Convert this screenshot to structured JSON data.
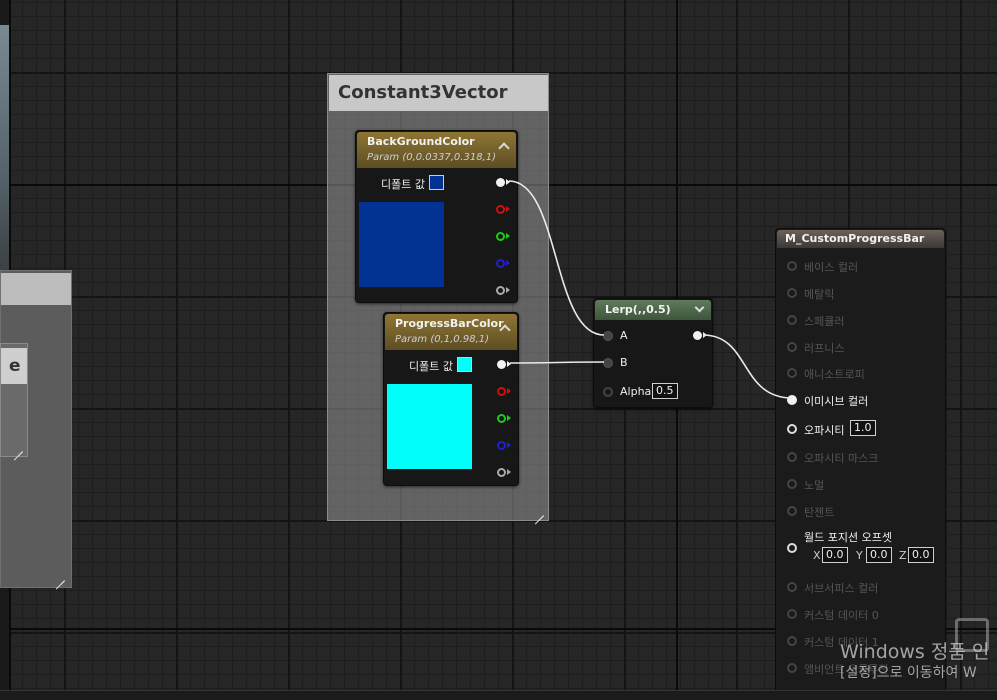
{
  "comment_box": {
    "title": "Constant3Vector"
  },
  "left_fragment": {
    "letter": "e"
  },
  "nodes": {
    "background_color": {
      "title": "BackGroundColor",
      "subtitle": "Param (0,0.0337,0.318,1)",
      "default_label": "디폴트 값",
      "color": "#023294"
    },
    "progress_bar_color": {
      "title": "ProgressBarColor",
      "subtitle": "Param (0,1,0.98,1)",
      "default_label": "디폴트 값",
      "color": "#00fffb"
    },
    "lerp": {
      "title": "Lerp(,,0.5)",
      "pin_a": "A",
      "pin_b": "B",
      "pin_alpha": "Alpha",
      "alpha_value": "0.5"
    },
    "result": {
      "title": "M_CustomProgressBar",
      "inputs": [
        "베이스 컬러",
        "메탈릭",
        "스페큘러",
        "러프니스",
        "애니소트로피",
        "이미시브 컬러",
        "오파시티",
        "오파시티 마스크",
        "노멀",
        "탄젠트",
        "월드 포지션 오프셋",
        "서브서피스 컬러",
        "커스텀 데이터 0",
        "커스텀 데이터 1",
        "앰비언트 오클루전"
      ],
      "opacity_value": "1.0",
      "wpo_x_label": "X",
      "wpo_x": "0.0",
      "wpo_y_label": "Y",
      "wpo_y": "0.0",
      "wpo_z_label": "Z",
      "wpo_z": "0.0"
    }
  },
  "watermark": {
    "line1": "Windows 정품 인",
    "line2": "[설정]으로 이동하여 W"
  }
}
